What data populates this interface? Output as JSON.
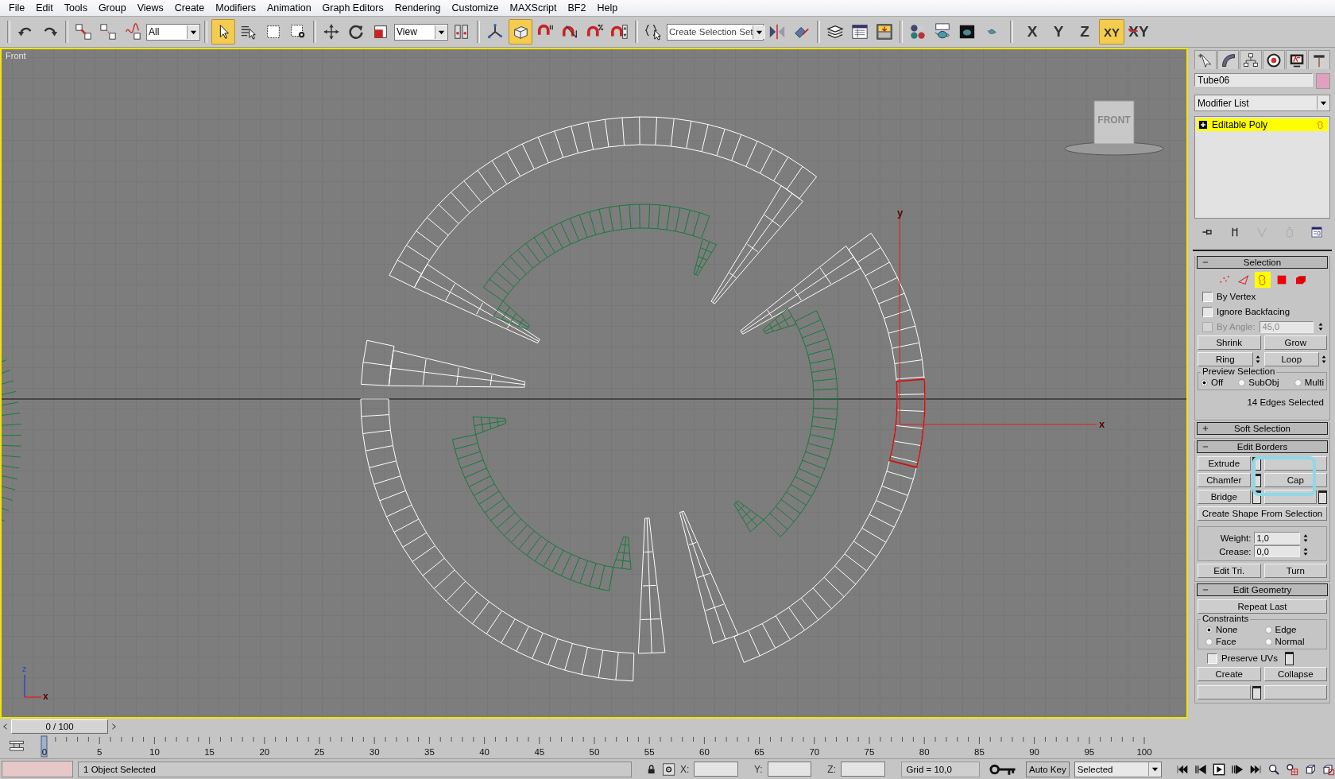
{
  "menu": [
    "File",
    "Edit",
    "Tools",
    "Group",
    "Views",
    "Create",
    "Modifiers",
    "Animation",
    "Graph Editors",
    "Rendering",
    "Customize",
    "MAXScript",
    "BF2",
    "Help"
  ],
  "toolbar": [
    [
      {
        "kind": "icon",
        "selected": false
      },
      {
        "kind": "icon",
        "selected": false
      }
    ],
    [
      {
        "kind": "icon",
        "selected": false
      },
      {
        "kind": "icon",
        "selected": false
      },
      {
        "kind": "icon",
        "selected": false
      },
      {
        "kind": "dropdown",
        "value": "All"
      }
    ],
    [
      {
        "kind": "icon",
        "selected": true
      },
      {
        "kind": "icon",
        "selected": false
      },
      {
        "kind": "icon",
        "selected": false
      },
      {
        "kind": "icon",
        "selected": false
      }
    ],
    [
      {
        "kind": "icon",
        "selected": false
      },
      {
        "kind": "icon",
        "selected": false
      },
      {
        "kind": "icon",
        "selected": false
      },
      {
        "kind": "dropdown",
        "value": "View"
      },
      {
        "kind": "icon",
        "selected": false
      }
    ],
    [
      {
        "kind": "icon",
        "selected": false
      },
      {
        "kind": "icon",
        "selected": true
      },
      {
        "kind": "icon",
        "selected": false
      },
      {
        "kind": "icon",
        "selected": false
      },
      {
        "kind": "icon",
        "selected": false
      },
      {
        "kind": "icon",
        "selected": false
      }
    ],
    [
      {
        "kind": "icon",
        "selected": false
      },
      {
        "kind": "dropdown",
        "value": "Create Selection Set"
      },
      {
        "kind": "icon",
        "selected": false
      },
      {
        "kind": "icon",
        "selected": false
      }
    ],
    [
      {
        "kind": "icon",
        "selected": false
      },
      {
        "kind": "icon",
        "selected": false
      },
      {
        "kind": "icon",
        "selected": false
      }
    ],
    [
      {
        "kind": "icon",
        "selected": false
      },
      {
        "kind": "icon",
        "selected": false
      },
      {
        "kind": "icon",
        "selected": false
      },
      {
        "kind": "icon",
        "selected": false
      }
    ],
    [
      {
        "kind": "axis",
        "label": "X",
        "selected": false
      },
      {
        "kind": "axis",
        "label": "Y",
        "selected": false
      },
      {
        "kind": "axis",
        "label": "Z",
        "selected": false
      },
      {
        "kind": "axis",
        "label": "XY",
        "selected": true
      },
      {
        "kind": "axis",
        "label": "XY",
        "selected": false
      }
    ]
  ],
  "viewport": {
    "label": "Front",
    "viewcube": "FRONT",
    "gizmo_y": "y",
    "gizmo_x": "x",
    "corner_z": "z",
    "corner_x": "x"
  },
  "panel": {
    "object_name": "Tube06",
    "modifier_list": "Modifier List",
    "stack": [
      {
        "label": "Editable Poly",
        "selected": true
      }
    ],
    "selection": {
      "title": "Selection",
      "expanded": true,
      "levels": [
        {
          "selected": false
        },
        {
          "selected": false
        },
        {
          "selected": true
        },
        {
          "selected": false
        },
        {
          "selected": false
        }
      ],
      "options": [
        {
          "label": "By Vertex",
          "checked": false,
          "disabled": false
        },
        {
          "label": "Ignore Backfacing",
          "checked": false,
          "disabled": false
        },
        {
          "label": "By Angle:",
          "checked": false,
          "disabled": true,
          "value": "45,0"
        }
      ],
      "buttons": [
        {
          "label": "Shrink",
          "spinner": false
        },
        {
          "label": "Grow",
          "spinner": false
        },
        {
          "label": "Ring",
          "spinner": true
        },
        {
          "label": "Loop",
          "spinner": true
        }
      ],
      "preview": {
        "title": "Preview Selection",
        "options": [
          {
            "label": "Off",
            "selected": true
          },
          {
            "label": "SubObj",
            "selected": false
          },
          {
            "label": "Multi",
            "selected": false
          }
        ]
      },
      "status": "14 Edges Selected"
    },
    "soft_selection": {
      "title": "Soft Selection",
      "expanded": false
    },
    "edit_borders": {
      "title": "Edit Borders",
      "expanded": true,
      "buttons": [
        {
          "label": "Extrude",
          "settings": true
        },
        {
          "settings": false
        },
        {
          "label": "Chamfer",
          "settings": true
        },
        {
          "label": "Cap",
          "settings": false
        },
        {
          "label": "Bridge",
          "settings": true
        },
        {
          "settings": true
        }
      ],
      "create_shape": "Create Shape From Selection",
      "fields": [
        {
          "label": "Weight:",
          "value": "1,0"
        },
        {
          "label": "Crease:",
          "value": "0,0"
        }
      ],
      "tri_buttons": [
        "Edit Tri.",
        "Turn"
      ]
    },
    "edit_geometry": {
      "title": "Edit Geometry",
      "expanded": true,
      "repeat": "Repeat Last",
      "constraints": {
        "title": "Constraints",
        "options": [
          {
            "label": "None",
            "selected": true
          },
          {
            "label": "Edge",
            "selected": false
          },
          {
            "label": "Face",
            "selected": false
          },
          {
            "label": "Normal",
            "selected": false
          }
        ]
      },
      "preserve_uvs": {
        "label": "Preserve UVs",
        "checked": false
      },
      "buttons": [
        "Create",
        "Collapse"
      ]
    }
  },
  "time_slider": "0 / 100",
  "ruler_labels": [
    "0",
    "5",
    "10",
    "15",
    "20",
    "25",
    "30",
    "35",
    "40",
    "45",
    "50",
    "55",
    "60",
    "65",
    "70",
    "75",
    "80",
    "85",
    "90",
    "95",
    "100"
  ],
  "status": {
    "prompt": "1 Object Selected",
    "coords": [
      "X:",
      "Y:",
      "Z:"
    ],
    "grid": "Grid = 10,0",
    "auto_key": "Auto Key",
    "key_filter": "Selected"
  }
}
